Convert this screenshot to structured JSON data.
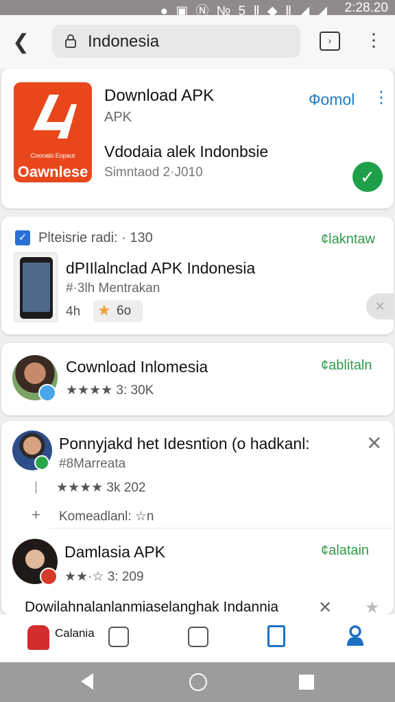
{
  "status_bar": {
    "icons": "● ▣ Ⓝ № 5 Ⅱ ◆ Ⅱ ◢ ◢",
    "time": "2:28.20"
  },
  "browser": {
    "url": "Indonesia"
  },
  "cards": [
    {
      "icon_subtext": "Coonalo Eopaut",
      "icon_brand": "Oawnlese",
      "title": "Download APK",
      "subtitle": "APK",
      "description": "Vdodaia alek Indonbsie",
      "date": "Simntaod 2·J010",
      "action": "Фomol"
    },
    {
      "header": "Plteisrie radi: · 130",
      "action": "¢lakntaw",
      "title": "dPIIlalnclad APK Indonesia",
      "subtitle": "#·3lh Mentrakan",
      "meta": "4h",
      "badge": "6o"
    },
    {
      "title": "Cownload Inlomesia",
      "rating": "★★★★ 3: 30K",
      "action": "¢ablitaln"
    },
    {
      "title": "Ponnyjakd het Idesntion (o hadkanl:",
      "subtitle": "#8Marreata",
      "rating": "★★★★ 3k 202",
      "comment": "Komeadlanl: ☆n"
    },
    {
      "title": "Damlasia APK",
      "rating": "★★·☆ 3: 209",
      "action": "¢alatain",
      "snippet": "Dowilahnalanlanmiaselanghak Indannia"
    }
  ],
  "bottom_nav": {
    "home_label": "Calania"
  },
  "colors": {
    "accent_green": "#2d9b4a",
    "accent_blue": "#1d7cc4",
    "app_icon": "#e8471c"
  }
}
